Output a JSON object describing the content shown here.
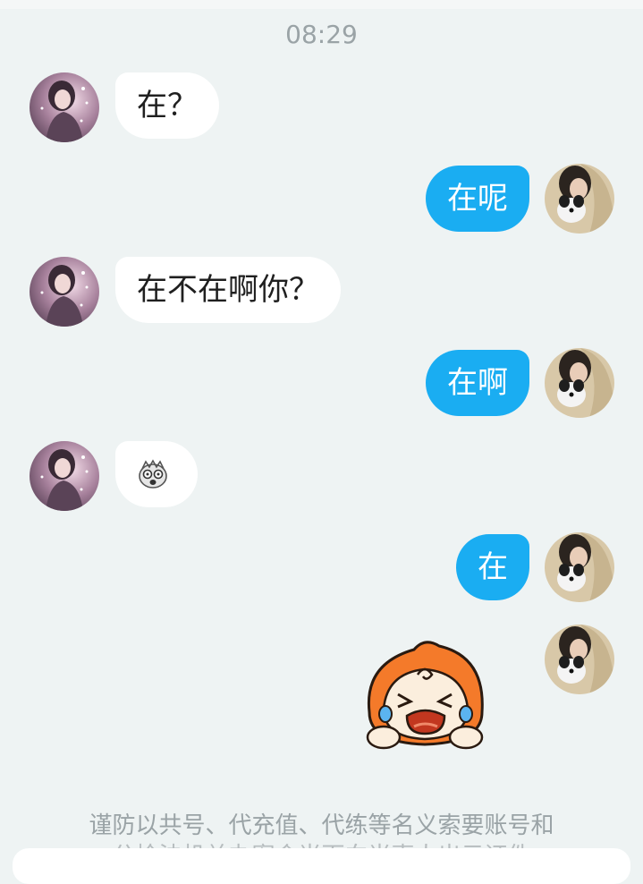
{
  "chat": {
    "timestamp": "08:29",
    "messages": [
      {
        "sender": "other",
        "type": "text",
        "text": "在？"
      },
      {
        "sender": "me",
        "type": "text",
        "text": "在呢"
      },
      {
        "sender": "other",
        "type": "text",
        "text": "在不在啊你？"
      },
      {
        "sender": "me",
        "type": "text",
        "text": "在啊"
      },
      {
        "sender": "other",
        "type": "emoji",
        "icon": "shocked-face-emoji-icon"
      },
      {
        "sender": "me",
        "type": "text",
        "text": "在"
      },
      {
        "sender": "me",
        "type": "sticker",
        "icon": "crying-mascot-sticker-icon"
      }
    ],
    "notice_line1": "谨防以共号、代充值、代练等名义索要账号和",
    "notice_line2": "公检法机关办案会当面向当事人出示证件"
  },
  "colors": {
    "background": "#eef3f3",
    "incoming_bubble": "#ffffff",
    "outgoing_bubble": "#1aadf2",
    "timestamp_text": "#9aa3a6"
  }
}
